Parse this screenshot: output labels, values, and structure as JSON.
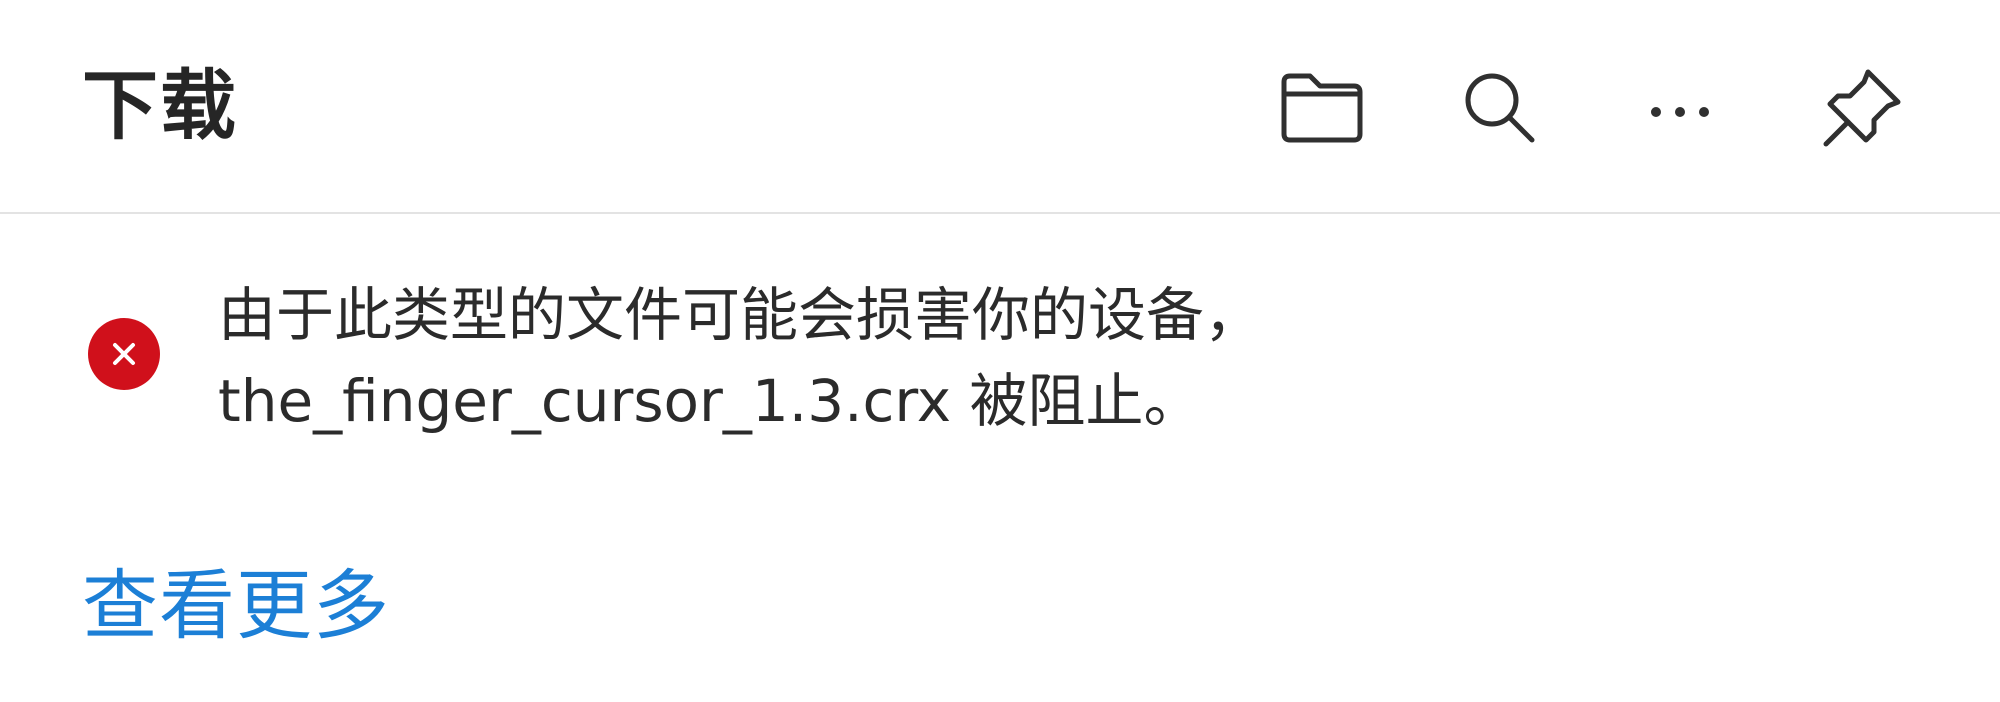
{
  "header": {
    "title": "下载",
    "icons": {
      "folder": "folder-icon",
      "search": "search-icon",
      "more": "more-icon",
      "pin": "pin-icon"
    }
  },
  "download_item": {
    "status_icon": "error-icon",
    "status_color": "#d0101b",
    "message_line1": "由于此类型的文件可能会损害你的设备，",
    "message_line2": "the_finger_cursor_1.3.crx 被阻止。"
  },
  "footer": {
    "see_more_label": "查看更多",
    "link_color": "#1c7fd6"
  }
}
